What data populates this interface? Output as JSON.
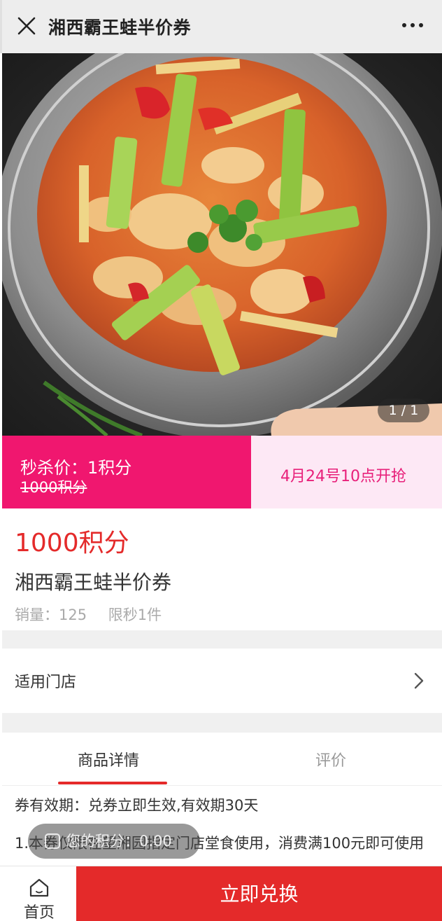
{
  "header": {
    "title": "湘西霸王蛙半价券",
    "close_icon": "close-icon",
    "more_icon": "more-dots-icon"
  },
  "banner": {
    "pager": "1 / 1"
  },
  "flash_sale": {
    "price_label": "秒杀价：1积分",
    "original_price": "1000积分",
    "start_time": "4月24号10点开抢"
  },
  "product": {
    "points": "1000积分",
    "name": "湘西霸王蛙半价券",
    "sales": "销量：125",
    "limit": "限秒1件"
  },
  "store": {
    "label": "适用门店"
  },
  "tabs": [
    {
      "label": "商品详情",
      "active": true
    },
    {
      "label": "评价",
      "active": false
    }
  ],
  "details": {
    "line1": "券有效期：兑券立即生效,有效期30天",
    "line2": "1.本券仅限在望湘园指定门店堂食使用，消费满100元即可使用"
  },
  "toast": {
    "text": "您的积分：0.00"
  },
  "bottom_bar": {
    "home_label": "首页",
    "exchange_label": "立即兑换"
  },
  "colors": {
    "accent_red": "#e42a2a",
    "flash_pink": "#f0176f",
    "flash_light": "#fde8f5"
  }
}
